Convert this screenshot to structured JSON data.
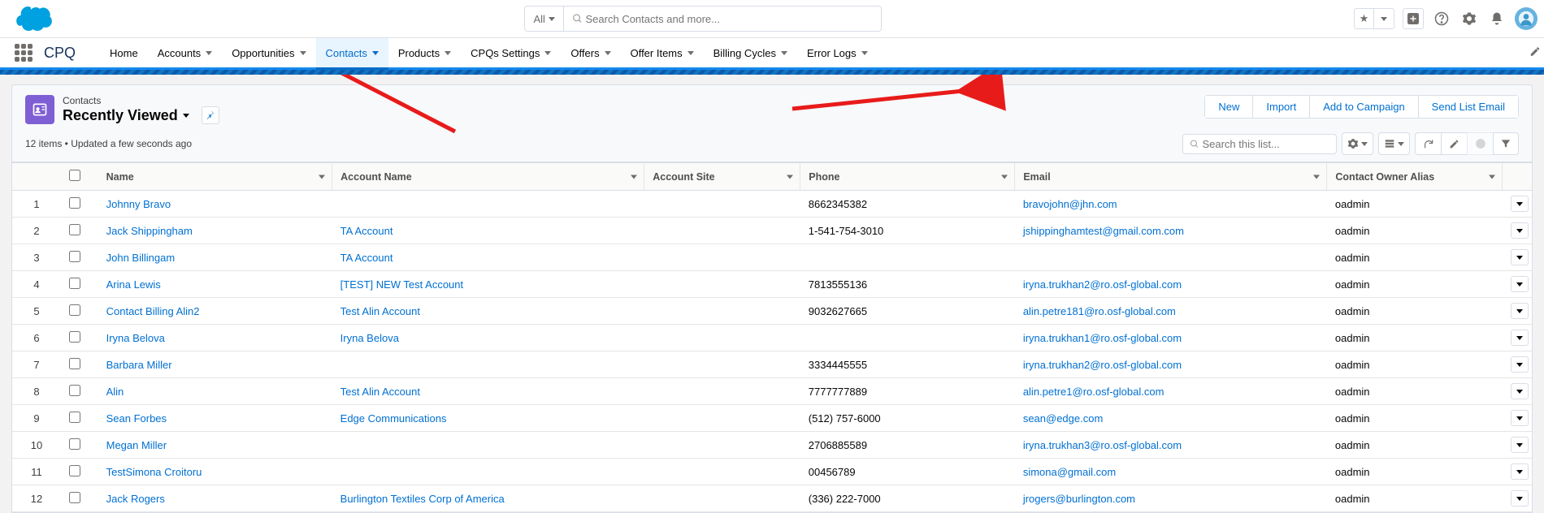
{
  "search": {
    "scope": "All",
    "placeholder": "Search Contacts and more..."
  },
  "app_name": "CPQ",
  "nav": [
    {
      "label": "Home",
      "caret": false,
      "active": false
    },
    {
      "label": "Accounts",
      "caret": true,
      "active": false
    },
    {
      "label": "Opportunities",
      "caret": true,
      "active": false
    },
    {
      "label": "Contacts",
      "caret": true,
      "active": true
    },
    {
      "label": "Products",
      "caret": true,
      "active": false
    },
    {
      "label": "CPQs Settings",
      "caret": true,
      "active": false
    },
    {
      "label": "Offers",
      "caret": true,
      "active": false
    },
    {
      "label": "Offer Items",
      "caret": true,
      "active": false
    },
    {
      "label": "Billing Cycles",
      "caret": true,
      "active": false
    },
    {
      "label": "Error Logs",
      "caret": true,
      "active": false
    }
  ],
  "object_label": "Contacts",
  "view_name": "Recently Viewed",
  "meta": "12 items • Updated a few seconds ago",
  "actions": {
    "new": "New",
    "import": "Import",
    "campaign": "Add to Campaign",
    "sendlist": "Send List Email"
  },
  "list_search_placeholder": "Search this list...",
  "columns": {
    "name": "Name",
    "account": "Account Name",
    "site": "Account Site",
    "phone": "Phone",
    "email": "Email",
    "owner": "Contact Owner Alias"
  },
  "rows": [
    {
      "n": "1",
      "name": "Johnny Bravo",
      "account": "",
      "site": "",
      "phone": "8662345382",
      "email": "bravojohn@jhn.com",
      "owner": "oadmin"
    },
    {
      "n": "2",
      "name": "Jack Shippingham",
      "account": "TA Account",
      "site": "",
      "phone": "1-541-754-3010",
      "email": "jshippinghamtest@gmail.com.com",
      "owner": "oadmin"
    },
    {
      "n": "3",
      "name": "John Billingam",
      "account": "TA Account",
      "site": "",
      "phone": "",
      "email": "",
      "owner": "oadmin"
    },
    {
      "n": "4",
      "name": "Arina Lewis",
      "account": "[TEST] NEW Test Account",
      "site": "",
      "phone": "7813555136",
      "email": "iryna.trukhan2@ro.osf-global.com",
      "owner": "oadmin"
    },
    {
      "n": "5",
      "name": "Contact Billing Alin2",
      "account": "Test Alin Account",
      "site": "",
      "phone": "9032627665",
      "email": "alin.petre181@ro.osf-global.com",
      "owner": "oadmin"
    },
    {
      "n": "6",
      "name": "Iryna Belova",
      "account": "Iryna Belova",
      "site": "",
      "phone": "",
      "email": "iryna.trukhan1@ro.osf-global.com",
      "owner": "oadmin"
    },
    {
      "n": "7",
      "name": "Barbara Miller",
      "account": "",
      "site": "",
      "phone": "3334445555",
      "email": "iryna.trukhan2@ro.osf-global.com",
      "owner": "oadmin"
    },
    {
      "n": "8",
      "name": "Alin",
      "account": "Test Alin Account",
      "site": "",
      "phone": "7777777889",
      "email": "alin.petre1@ro.osf-global.com",
      "owner": "oadmin"
    },
    {
      "n": "9",
      "name": "Sean Forbes",
      "account": "Edge Communications",
      "site": "",
      "phone": "(512) 757-6000",
      "email": "sean@edge.com",
      "owner": "oadmin"
    },
    {
      "n": "10",
      "name": "Megan Miller",
      "account": "",
      "site": "",
      "phone": "2706885589",
      "email": "iryna.trukhan3@ro.osf-global.com",
      "owner": "oadmin"
    },
    {
      "n": "11",
      "name": "TestSimona Croitoru",
      "account": "",
      "site": "",
      "phone": "00456789",
      "email": "simona@gmail.com",
      "owner": "oadmin"
    },
    {
      "n": "12",
      "name": "Jack Rogers",
      "account": "Burlington Textiles Corp of America",
      "site": "",
      "phone": "(336) 222-7000",
      "email": "jrogers@burlington.com",
      "owner": "oadmin"
    }
  ]
}
